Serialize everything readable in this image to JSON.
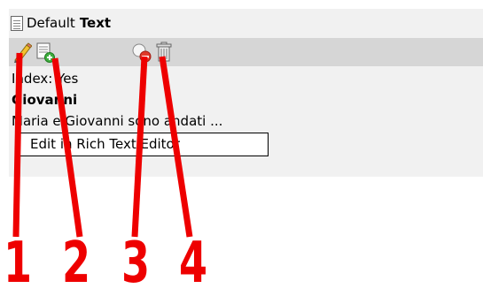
{
  "header": {
    "title_prefix": "Default",
    "title_bold": "Text",
    "icon": "document-icon"
  },
  "toolbar": {
    "buttons": [
      {
        "name": "edit",
        "icon": "pencil-icon"
      },
      {
        "name": "new",
        "icon": "new-document-icon"
      },
      {
        "name": "hide",
        "icon": "hide-icon"
      },
      {
        "name": "delete",
        "icon": "trash-icon"
      }
    ]
  },
  "content": {
    "index_line": "Index: Yes",
    "heading": "Giovanni",
    "excerpt": "Maria e Giovanni sono andati ..."
  },
  "tooltip": {
    "text": "Edit in Rich Text Editor"
  },
  "callouts": {
    "labels": [
      "1",
      "2",
      "3",
      "4"
    ],
    "color": "#ee0000"
  }
}
